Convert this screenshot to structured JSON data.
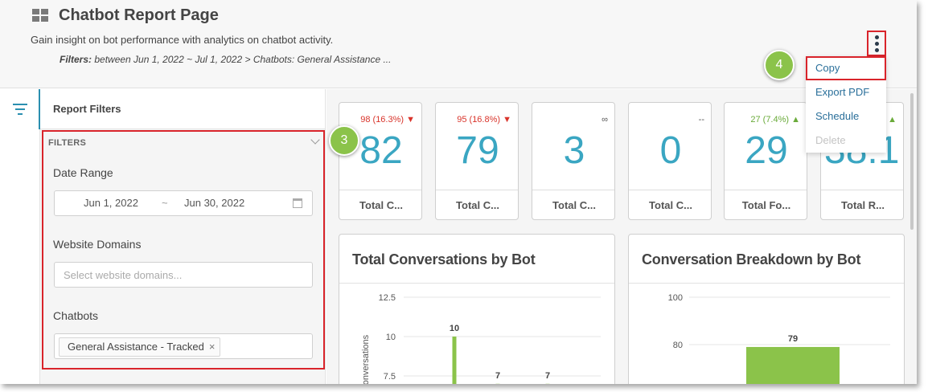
{
  "header": {
    "title": "Chatbot Report Page",
    "subtitle": "Gain insight on bot performance with analytics on chatbot activity.",
    "filters_label": "Filters:",
    "filters_text": " between Jun 1, 2022 ~ Jul 1, 2022 > Chatbots: General Assistance ..."
  },
  "menu": {
    "items": [
      {
        "label": "Copy"
      },
      {
        "label": "Export PDF"
      },
      {
        "label": "Schedule"
      },
      {
        "label": "Delete"
      }
    ]
  },
  "badges": {
    "filters": "3",
    "menu": "4"
  },
  "sidebar": {
    "title": "Report Filters",
    "section": "FILTERS",
    "date_range_label": "Date Range",
    "date_from": "Jun 1, 2022",
    "date_sep": "~",
    "date_to": "Jun 30, 2022",
    "domains_label": "Website Domains",
    "domains_placeholder": "Select website domains...",
    "chatbots_label": "Chatbots",
    "chatbot_tag": "General Assistance - Tracked",
    "tag_remove": "×"
  },
  "kpis": [
    {
      "delta": "98 (16.3%) ▼",
      "trend": "down",
      "value": "82",
      "label": "Total C..."
    },
    {
      "delta": "95 (16.8%) ▼",
      "trend": "down",
      "value": "79",
      "label": "Total C..."
    },
    {
      "delta": "∞",
      "trend": "none",
      "value": "3",
      "label": "Total C..."
    },
    {
      "delta": "--",
      "trend": "none",
      "value": "0",
      "label": "Total C..."
    },
    {
      "delta": "27 (7.4%) ▲",
      "trend": "up",
      "value": "29",
      "label": "Total Fo..."
    },
    {
      "delta": "▲",
      "trend": "up",
      "value": "38.1",
      "label": "Total R..."
    }
  ],
  "colors": {
    "accent": "#3aa6c2",
    "bar": "#8bc34a",
    "highlight": "#d9242b",
    "link": "#2a6f9a"
  },
  "chart_data": [
    {
      "type": "bar",
      "title": "Total Conversations by Bot",
      "ylabel": "Conversations",
      "yticks": [
        "12.5",
        "10",
        "7.5"
      ],
      "ylim": [
        7.5,
        12.5
      ],
      "series": [
        {
          "values": [
            10,
            7,
            7
          ]
        }
      ],
      "data_labels": [
        "10",
        "7",
        "7"
      ]
    },
    {
      "type": "bar",
      "title": "Conversation Breakdown by Bot",
      "yticks": [
        "100",
        "80"
      ],
      "ylim": [
        80,
        100
      ],
      "series": [
        {
          "values": [
            79
          ]
        }
      ],
      "data_labels": [
        "79"
      ]
    }
  ]
}
